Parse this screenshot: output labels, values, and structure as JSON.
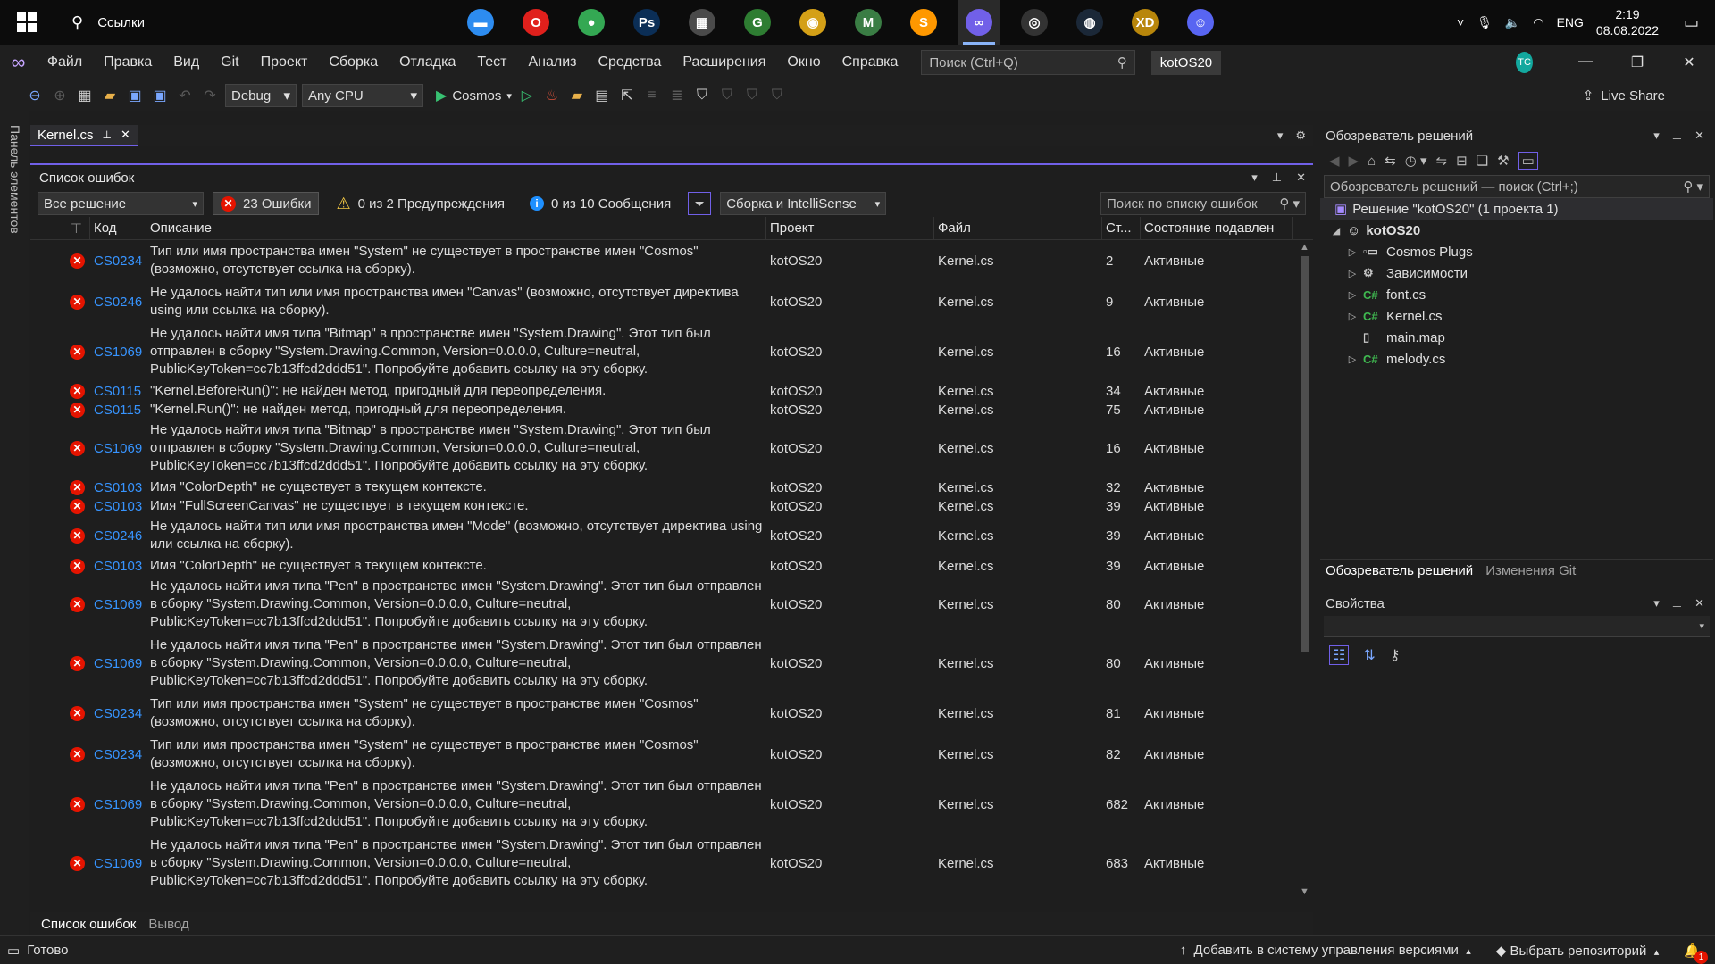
{
  "taskbar": {
    "search_text": "Ссылки",
    "language": "ENG",
    "time": "2:19",
    "date": "08.08.2022",
    "apps": [
      {
        "icon": "explorer-icon",
        "glyph": "▬",
        "color": "#2d8cf0"
      },
      {
        "icon": "opera-icon",
        "glyph": "O",
        "color": "#e0201c"
      },
      {
        "icon": "chrome-icon",
        "glyph": "●",
        "color": "#34a853"
      },
      {
        "icon": "photoshop-icon",
        "glyph": "Ps",
        "color": "#0b2e56"
      },
      {
        "icon": "film-icon",
        "glyph": "▦",
        "color": "#4a4a4a"
      },
      {
        "icon": "g-app-icon",
        "glyph": "G",
        "color": "#2e7d32"
      },
      {
        "icon": "disc-icon",
        "glyph": "◉",
        "color": "#d4a017"
      },
      {
        "icon": "mc-icon",
        "glyph": "M",
        "color": "#3a7d44"
      },
      {
        "icon": "sublime-icon",
        "glyph": "S",
        "color": "#ff9800"
      },
      {
        "icon": "visual-studio-icon",
        "glyph": "∞",
        "color": "#7160e8"
      },
      {
        "icon": "obs-icon",
        "glyph": "◎",
        "color": "#333333"
      },
      {
        "icon": "steam-icon",
        "glyph": "◍",
        "color": "#1b2838"
      },
      {
        "icon": "xd-app-icon",
        "glyph": "XD",
        "color": "#b8860b"
      },
      {
        "icon": "discord-icon",
        "glyph": "☺",
        "color": "#5865f2"
      }
    ]
  },
  "menu": {
    "items": [
      "Файл",
      "Правка",
      "Вид",
      "Git",
      "Проект",
      "Сборка",
      "Отладка",
      "Тест",
      "Анализ",
      "Средства",
      "Расширения",
      "Окно",
      "Справка"
    ],
    "search_placeholder": "Поиск (Ctrl+Q)",
    "solution_name": "kotOS20",
    "avatar_initials": "TC"
  },
  "toolbar": {
    "config": "Debug",
    "platform": "Any CPU",
    "run_target": "Cosmos",
    "live_share": "Live Share"
  },
  "left_strip": {
    "label": "Панель элементов"
  },
  "doc_tab": {
    "label": "Kernel.cs"
  },
  "error_list": {
    "title": "Список ошибок",
    "scope": "Все решение",
    "errors_filter": "23 Ошибки",
    "warnings_filter": "0 из 2 Предупреждения",
    "messages_filter": "0 из 10 Сообщения",
    "build_filter": "Сборка и IntelliSense",
    "search_placeholder": "Поиск по списку ошибок",
    "columns": [
      "Код",
      "Описание",
      "Проект",
      "Файл",
      "Ст...",
      "Состояние подавлен"
    ],
    "rows": [
      {
        "code": "CS0234",
        "desc": "Тип или имя пространства имен \"System\" не существует в пространстве имен \"Cosmos\" (возможно, отсутствует ссылка на сборку).",
        "project": "kotOS20",
        "file": "Kernel.cs",
        "line": "2",
        "state": "Активные"
      },
      {
        "code": "CS0246",
        "desc": "Не удалось найти тип или имя пространства имен \"Canvas\" (возможно, отсутствует директива using или ссылка на сборку).",
        "project": "kotOS20",
        "file": "Kernel.cs",
        "line": "9",
        "state": "Активные"
      },
      {
        "code": "CS1069",
        "desc": "Не удалось найти имя типа \"Bitmap\" в пространстве имен \"System.Drawing\". Этот тип был отправлен в сборку \"System.Drawing.Common, Version=0.0.0.0, Culture=neutral, PublicKeyToken=cc7b13ffcd2ddd51\". Попробуйте добавить ссылку на эту сборку.",
        "project": "kotOS20",
        "file": "Kernel.cs",
        "line": "16",
        "state": "Активные"
      },
      {
        "code": "CS0115",
        "desc": "\"Kernel.BeforeRun()\": не найден метод, пригодный для переопределения.",
        "project": "kotOS20",
        "file": "Kernel.cs",
        "line": "34",
        "state": "Активные"
      },
      {
        "code": "CS0115",
        "desc": "\"Kernel.Run()\": не найден метод, пригодный для переопределения.",
        "project": "kotOS20",
        "file": "Kernel.cs",
        "line": "75",
        "state": "Активные"
      },
      {
        "code": "CS1069",
        "desc": "Не удалось найти имя типа \"Bitmap\" в пространстве имен \"System.Drawing\". Этот тип был отправлен в сборку \"System.Drawing.Common, Version=0.0.0.0, Culture=neutral, PublicKeyToken=cc7b13ffcd2ddd51\". Попробуйте добавить ссылку на эту сборку.",
        "project": "kotOS20",
        "file": "Kernel.cs",
        "line": "16",
        "state": "Активные"
      },
      {
        "code": "CS0103",
        "desc": "Имя \"ColorDepth\" не существует в текущем контексте.",
        "project": "kotOS20",
        "file": "Kernel.cs",
        "line": "32",
        "state": "Активные"
      },
      {
        "code": "CS0103",
        "desc": "Имя \"FullScreenCanvas\" не существует в текущем контексте.",
        "project": "kotOS20",
        "file": "Kernel.cs",
        "line": "39",
        "state": "Активные"
      },
      {
        "code": "CS0246",
        "desc": "Не удалось найти тип или имя пространства имен \"Mode\" (возможно, отсутствует директива using или ссылка на сборку).",
        "project": "kotOS20",
        "file": "Kernel.cs",
        "line": "39",
        "state": "Активные"
      },
      {
        "code": "CS0103",
        "desc": "Имя \"ColorDepth\" не существует в текущем контексте.",
        "project": "kotOS20",
        "file": "Kernel.cs",
        "line": "39",
        "state": "Активные"
      },
      {
        "code": "CS1069",
        "desc": "Не удалось найти имя типа \"Pen\" в пространстве имен \"System.Drawing\". Этот тип был отправлен в сборку \"System.Drawing.Common, Version=0.0.0.0, Culture=neutral, PublicKeyToken=cc7b13ffcd2ddd51\". Попробуйте добавить ссылку на эту сборку.",
        "project": "kotOS20",
        "file": "Kernel.cs",
        "line": "80",
        "state": "Активные"
      },
      {
        "code": "CS1069",
        "desc": "Не удалось найти имя типа \"Pen\" в пространстве имен \"System.Drawing\". Этот тип был отправлен в сборку \"System.Drawing.Common, Version=0.0.0.0, Culture=neutral, PublicKeyToken=cc7b13ffcd2ddd51\". Попробуйте добавить ссылку на эту сборку.",
        "project": "kotOS20",
        "file": "Kernel.cs",
        "line": "80",
        "state": "Активные"
      },
      {
        "code": "CS0234",
        "desc": "Тип или имя пространства имен \"System\" не существует в пространстве имен \"Cosmos\" (возможно, отсутствует ссылка на сборку).",
        "project": "kotOS20",
        "file": "Kernel.cs",
        "line": "81",
        "state": "Активные"
      },
      {
        "code": "CS0234",
        "desc": "Тип или имя пространства имен \"System\" не существует в пространстве имен \"Cosmos\" (возможно, отсутствует ссылка на сборку).",
        "project": "kotOS20",
        "file": "Kernel.cs",
        "line": "82",
        "state": "Активные"
      },
      {
        "code": "CS1069",
        "desc": "Не удалось найти имя типа \"Pen\" в пространстве имен \"System.Drawing\". Этот тип был отправлен в сборку \"System.Drawing.Common, Version=0.0.0.0, Culture=neutral, PublicKeyToken=cc7b13ffcd2ddd51\". Попробуйте добавить ссылку на эту сборку.",
        "project": "kotOS20",
        "file": "Kernel.cs",
        "line": "682",
        "state": "Активные"
      },
      {
        "code": "CS1069",
        "desc": "Не удалось найти имя типа \"Pen\" в пространстве имен \"System.Drawing\". Этот тип был отправлен в сборку \"System.Drawing.Common, Version=0.0.0.0, Culture=neutral, PublicKeyToken=cc7b13ffcd2ddd51\". Попробуйте добавить ссылку на эту сборку.",
        "project": "kotOS20",
        "file": "Kernel.cs",
        "line": "683",
        "state": "Активные"
      }
    ],
    "bottom_tabs": [
      "Список ошибок",
      "Вывод"
    ]
  },
  "solution_explorer": {
    "title": "Обозреватель решений",
    "search_placeholder": "Обозреватель решений — поиск (Ctrl+;)",
    "solution_label": "Решение \"kotOS20\" (1 проекта 1)",
    "project": "kotOS20",
    "items": [
      {
        "label": "Cosmos Plugs",
        "icon": "reference-icon",
        "expandable": true
      },
      {
        "label": "Зависимости",
        "icon": "dependencies-icon",
        "expandable": true
      },
      {
        "label": "font.cs",
        "icon": "csharp-file-icon",
        "expandable": true
      },
      {
        "label": "Kernel.cs",
        "icon": "csharp-file-icon",
        "expandable": true
      },
      {
        "label": "main.map",
        "icon": "file-icon",
        "expandable": false
      },
      {
        "label": "melody.cs",
        "icon": "csharp-file-icon",
        "expandable": true
      }
    ],
    "tabs": [
      "Обозреватель решений",
      "Изменения Git"
    ]
  },
  "properties": {
    "title": "Свойства"
  },
  "status": {
    "ready": "Готово",
    "source_control": "Добавить в систему управления версиями",
    "repo": "Выбрать репозиторий",
    "notifications": "1"
  }
}
